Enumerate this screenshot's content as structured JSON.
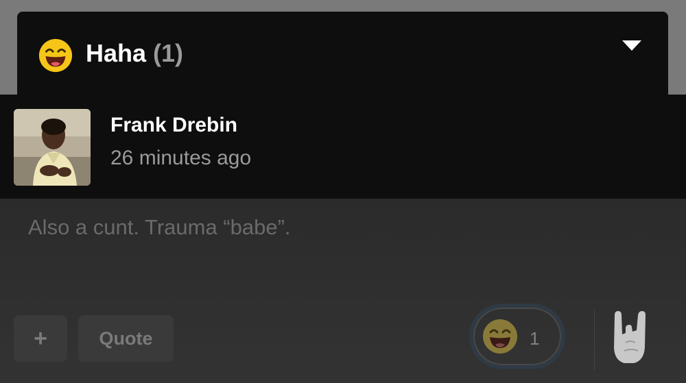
{
  "sheet": {
    "reaction_name": "Haha",
    "reaction_count": "(1)",
    "reaction_icon": "laughing-face-icon",
    "collapse_icon": "chevron-down-icon"
  },
  "reactors": [
    {
      "name": "Frank Drebin",
      "time": "26 minutes ago",
      "avatar": "avatar-photo"
    }
  ],
  "post": {
    "text": "Also a cunt. Trauma “babe”."
  },
  "actions": {
    "plus_label": "+",
    "quote_label": "Quote",
    "reaction_count": "1",
    "reaction_icon": "laughing-face-icon",
    "react_icon": "rock-hand-icon"
  },
  "colors": {
    "sheet_bg": "#0e0e0e",
    "dim_bg": "#2b2b2b",
    "emoji_yellow": "#f5c518",
    "muted_text": "#9a9a9a"
  }
}
